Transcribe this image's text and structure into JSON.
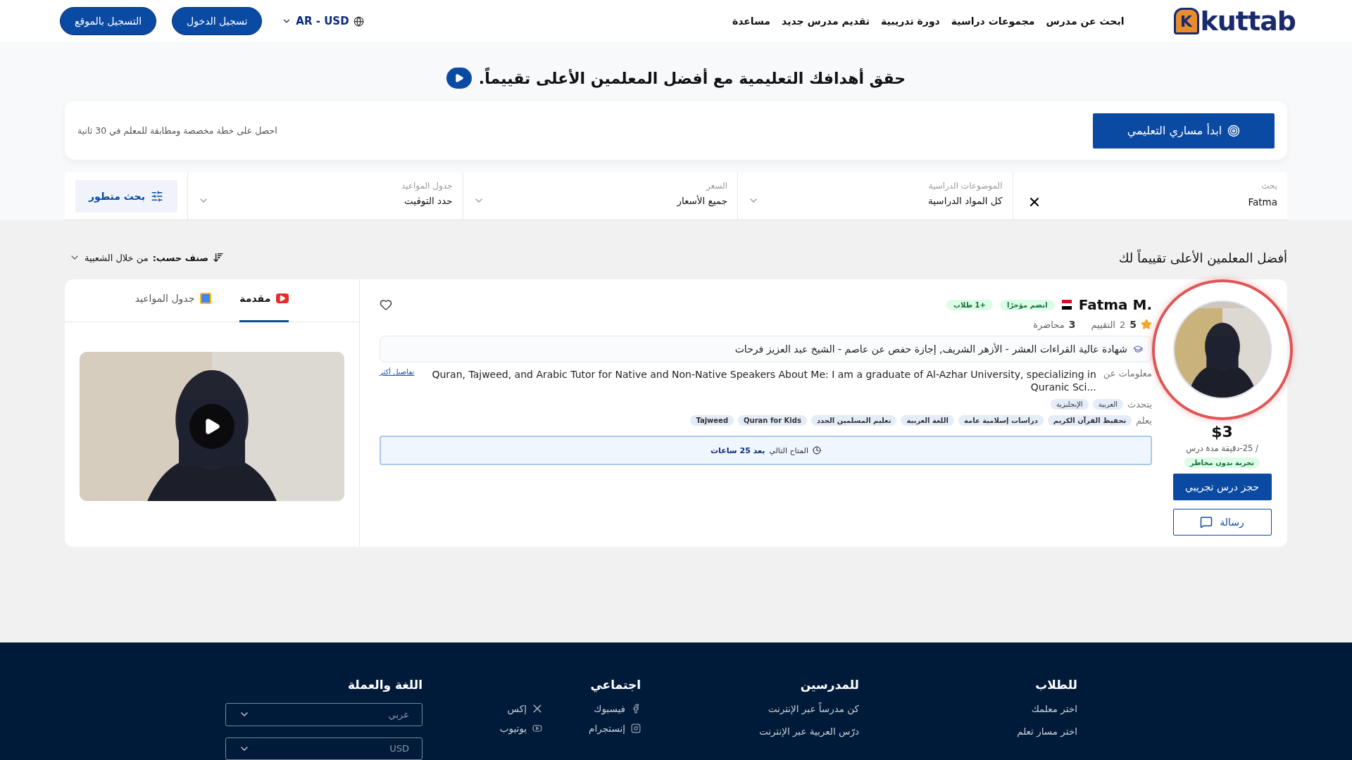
{
  "header": {
    "logo": "kuttab",
    "logo_letter": "K",
    "nav": [
      "ابحث عن مدرس",
      "مجموعات دراسية",
      "دورة تدريبية",
      "تقديم مدرس جديد",
      "مساعدة"
    ],
    "locale": "AR - USD",
    "buttons": [
      "تسجيل الدخول",
      "التسجيل بالموقع"
    ]
  },
  "hero": {
    "title": "حقق أهدافك التعليمية مع أفضل المعلمين الأعلى تقييماً."
  },
  "plan": {
    "button": "ابدأ مساري التعليمي",
    "text": "احصل على خطة مخصصة ومطابقة للمعلم في 30 ثانية"
  },
  "filters": [
    {
      "kind": "search",
      "label": "بحث",
      "value": "Fatma"
    },
    {
      "kind": "select",
      "label": "الموضوعات الدراسية",
      "value": "كل المواد الدراسية"
    },
    {
      "kind": "select",
      "label": "السعر",
      "value": "جميع الأسعار"
    },
    {
      "kind": "select",
      "label": "جدول المواعيد",
      "value": "حدد التوقيت"
    }
  ],
  "advanced_search": "بحث متطور",
  "results": {
    "title": "أفضل المعلمين الأعلى تقييماً لك",
    "sort_label": "صنف حسب:",
    "sort_value": "من خلال الشعبية"
  },
  "teacher": {
    "name": "Fatma M.",
    "badges": [
      "انضم مؤخرًا",
      "+1 طلاب"
    ],
    "rating": "5",
    "reviews": "2",
    "reviews_label": "التقييم",
    "lectures": "3",
    "lectures_label": "محاضرة",
    "certificate": "شهادة عالية القراءات العشر - الأزهر الشريف, إجازة حفص عن عاصم - الشيخ عبد العزيز فرحات",
    "about_label": "معلومات عن",
    "about": "Quran, Tajweed, and Arabic Tutor for Native and Non-Native Speakers About Me: I am a graduate of Al-Azhar University, specializing in Quranic Sci...",
    "more": "تفاصيل أكثر",
    "speaks_label": "يتحدث",
    "languages": [
      "العربية",
      "الإنجليزية"
    ],
    "teaches_label": "يعلم",
    "subjects": [
      "تحفيظ القرآن الكريم",
      "دراسات إسلامية عامة",
      "اللغة العربية",
      "تعليم المسلمين الجدد",
      "Quran for Kids",
      "Tajweed"
    ],
    "next_label": "المتاح التالي",
    "next_value": "بعد 25 ساعات",
    "price": "$3",
    "duration": "/ 25-دقيقة مدة درس",
    "trial": "تجربة بدون مخاطر",
    "book": "حجز درس تجريبي",
    "message": "رسالة",
    "favorite": false,
    "highlighted": true
  },
  "media_tabs": [
    {
      "kind": "video",
      "label": "مقدمة",
      "selected": true
    },
    {
      "kind": "calendar",
      "label": "جدول المواعيد",
      "selected": false
    }
  ],
  "footer": {
    "columns": [
      {
        "kind": "links",
        "title": "للطلاب",
        "items": [
          {
            "label": "اختر معلمك"
          },
          {
            "label": "اختر مسار تعلم"
          }
        ]
      },
      {
        "kind": "links",
        "title": "للمدرسين",
        "items": [
          {
            "label": "كن مدرساً عبر الإنترنت"
          },
          {
            "label": "درّس العربية عبر الإنترنت"
          }
        ]
      },
      {
        "kind": "social",
        "title": "اجتماعي",
        "items": [
          {
            "label": "فيسبوك",
            "kind": "facebook"
          },
          {
            "label": "إكس",
            "kind": "x"
          },
          {
            "label": "إنستجرام",
            "kind": "instagram"
          },
          {
            "label": "يوتيوب",
            "kind": "youtube"
          }
        ]
      },
      {
        "kind": "selects",
        "title": "اللغة والعملة",
        "items": [
          {
            "label": "عربي"
          },
          {
            "label": "USD"
          }
        ]
      }
    ]
  }
}
